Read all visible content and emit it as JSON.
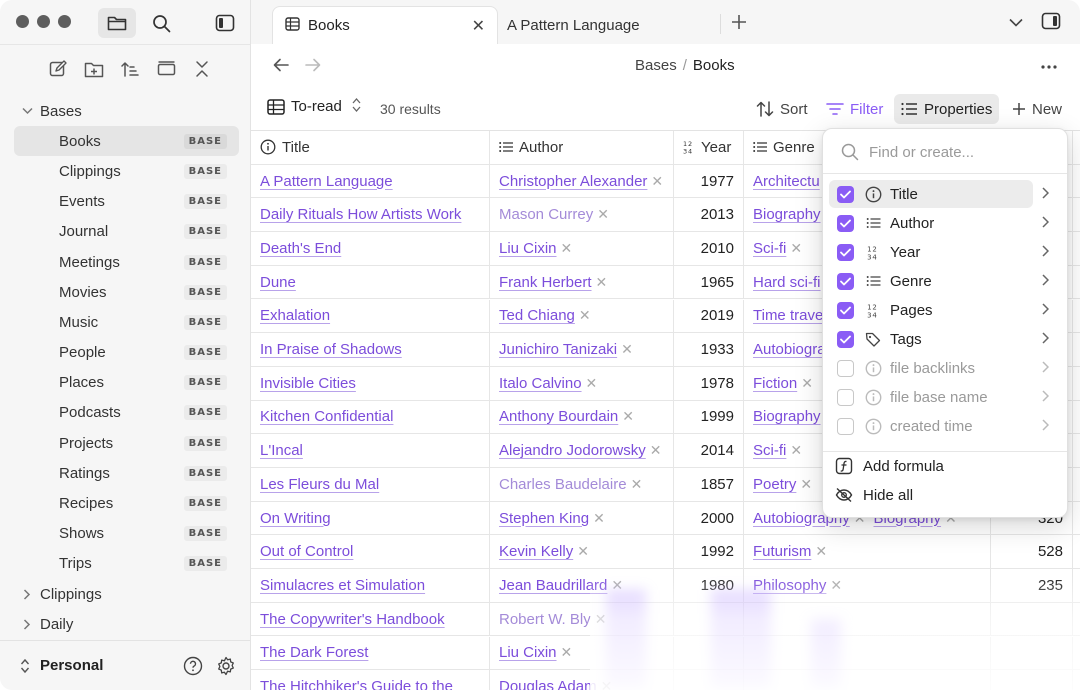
{
  "sidebar": {
    "items": [
      {
        "label": "Bases",
        "type": "folder",
        "expanded": true
      },
      {
        "label": "Books",
        "badge": "BASE",
        "selected": true
      },
      {
        "label": "Clippings",
        "badge": "BASE"
      },
      {
        "label": "Events",
        "badge": "BASE"
      },
      {
        "label": "Journal",
        "badge": "BASE"
      },
      {
        "label": "Meetings",
        "badge": "BASE"
      },
      {
        "label": "Movies",
        "badge": "BASE"
      },
      {
        "label": "Music",
        "badge": "BASE"
      },
      {
        "label": "People",
        "badge": "BASE"
      },
      {
        "label": "Places",
        "badge": "BASE"
      },
      {
        "label": "Podcasts",
        "badge": "BASE"
      },
      {
        "label": "Projects",
        "badge": "BASE"
      },
      {
        "label": "Ratings",
        "badge": "BASE"
      },
      {
        "label": "Recipes",
        "badge": "BASE"
      },
      {
        "label": "Shows",
        "badge": "BASE"
      },
      {
        "label": "Trips",
        "badge": "BASE"
      },
      {
        "label": "Clippings",
        "type": "folder",
        "expanded": false
      },
      {
        "label": "Daily",
        "type": "folder",
        "expanded": false
      }
    ],
    "vault": "Personal"
  },
  "tabs": [
    {
      "label": "Books",
      "active": true
    },
    {
      "label": "A Pattern Language",
      "active": false
    }
  ],
  "breadcrumb": {
    "parent": "Bases",
    "sep": "/",
    "current": "Books"
  },
  "toolbar": {
    "view": "To-read",
    "results": "30 results",
    "sort": "Sort",
    "filter": "Filter",
    "properties": "Properties",
    "new": "New"
  },
  "table": {
    "headers": {
      "title": "Title",
      "author": "Author",
      "year": "Year",
      "genre": "Genre"
    },
    "rows": [
      {
        "title": "A Pattern Language",
        "author": "Christopher Alexander",
        "author_muted": false,
        "year": "1977",
        "genre": [
          "Architectu"
        ],
        "pages": ""
      },
      {
        "title": "Daily Rituals How Artists Work",
        "author": "Mason Currey",
        "author_muted": true,
        "year": "2013",
        "genre": [
          "Biography"
        ],
        "pages": ""
      },
      {
        "title": "Death's End",
        "author": "Liu Cixin",
        "author_muted": false,
        "year": "2010",
        "genre": [
          "Sci-fi"
        ],
        "pages": ""
      },
      {
        "title": "Dune",
        "author": "Frank Herbert",
        "author_muted": false,
        "year": "1965",
        "genre": [
          "Hard sci-fi"
        ],
        "pages": ""
      },
      {
        "title": "Exhalation",
        "author": "Ted Chiang",
        "author_muted": false,
        "year": "2019",
        "genre": [
          "Time travel"
        ],
        "pages": ""
      },
      {
        "title": "In Praise of Shadows",
        "author": "Junichiro Tanizaki",
        "author_muted": false,
        "year": "1933",
        "genre": [
          "Autobiogra"
        ],
        "pages": ""
      },
      {
        "title": "Invisible Cities",
        "author": "Italo Calvino",
        "author_muted": false,
        "year": "1978",
        "genre": [
          "Fiction"
        ],
        "pages": ""
      },
      {
        "title": "Kitchen Confidential",
        "author": "Anthony Bourdain",
        "author_muted": false,
        "year": "1999",
        "genre": [
          "Biography"
        ],
        "pages": ""
      },
      {
        "title": "L'Incal",
        "author": "Alejandro Jodorowsky",
        "author_muted": false,
        "year": "2014",
        "genre": [
          "Sci-fi"
        ],
        "pages": ""
      },
      {
        "title": "Les Fleurs du Mal",
        "author": "Charles Baudelaire",
        "author_muted": true,
        "year": "1857",
        "genre": [
          "Poetry"
        ],
        "pages": ""
      },
      {
        "title": "On Writing",
        "author": "Stephen King",
        "author_muted": false,
        "year": "2000",
        "genre": [
          "Autobiography",
          "Biography"
        ],
        "pages": "320"
      },
      {
        "title": "Out of Control",
        "author": "Kevin Kelly",
        "author_muted": false,
        "year": "1992",
        "genre": [
          "Futurism"
        ],
        "pages": "528"
      },
      {
        "title": "Simulacres et Simulation",
        "author": "Jean Baudrillard",
        "author_muted": false,
        "year": "1980",
        "genre": [
          "Philosophy"
        ],
        "pages": "235"
      },
      {
        "title": "The Copywriter's Handbook",
        "author": "Robert W. Bly",
        "author_muted": true,
        "year": "",
        "genre": [],
        "pages": ""
      },
      {
        "title": "The Dark Forest",
        "author": "Liu Cixin",
        "author_muted": false,
        "year": "",
        "genre": [],
        "pages": ""
      },
      {
        "title": "The Hitchhiker's Guide to the",
        "author": "Douglas Adam",
        "author_muted": false,
        "year": "",
        "genre": [],
        "pages": ""
      }
    ]
  },
  "properties_menu": {
    "search_placeholder": "Find or create...",
    "items": [
      {
        "label": "Title",
        "checked": true,
        "icon": "info-icon"
      },
      {
        "label": "Author",
        "checked": true,
        "icon": "list-icon"
      },
      {
        "label": "Year",
        "checked": true,
        "icon": "number-icon"
      },
      {
        "label": "Genre",
        "checked": true,
        "icon": "list-icon"
      },
      {
        "label": "Pages",
        "checked": true,
        "icon": "number-icon"
      },
      {
        "label": "Tags",
        "checked": true,
        "icon": "tags-icon"
      },
      {
        "label": "file backlinks",
        "checked": false,
        "icon": "info-icon"
      },
      {
        "label": "file base name",
        "checked": false,
        "icon": "info-icon"
      },
      {
        "label": "created time",
        "checked": false,
        "icon": "info-icon"
      }
    ],
    "add_formula": "Add formula",
    "hide_all": "Hide all"
  },
  "colors": {
    "accent": "#8a5cf5",
    "link": "#7c4ddb"
  }
}
